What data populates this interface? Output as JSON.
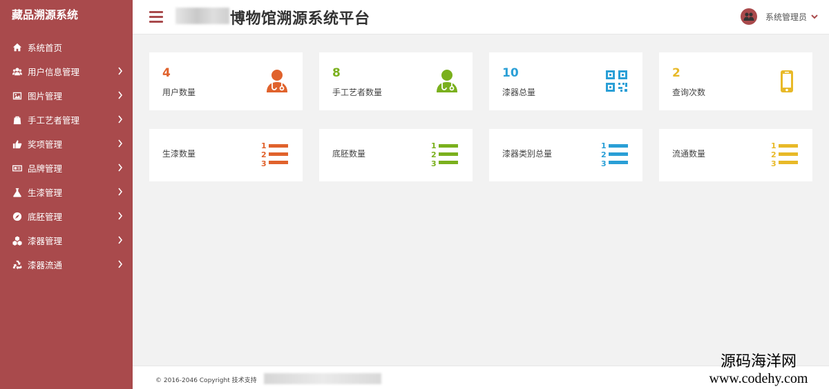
{
  "sidebar": {
    "brand": "藏品溯源系统",
    "items": [
      {
        "label": "系统首页",
        "icon": "home-icon"
      },
      {
        "label": "用户信息管理",
        "icon": "users-icon"
      },
      {
        "label": "图片管理",
        "icon": "image-icon"
      },
      {
        "label": "手工艺者管理",
        "icon": "bag-icon"
      },
      {
        "label": "奖项管理",
        "icon": "thumbs-up-icon"
      },
      {
        "label": "品牌管理",
        "icon": "id-card-icon"
      },
      {
        "label": "生漆管理",
        "icon": "flask-icon"
      },
      {
        "label": "底胚管理",
        "icon": "compass-icon"
      },
      {
        "label": "漆器管理",
        "icon": "cubes-icon"
      },
      {
        "label": "漆器流通",
        "icon": "recycle-icon"
      }
    ]
  },
  "header": {
    "title": "博物馆溯源系统平台",
    "user": "系统管理员"
  },
  "stats": [
    {
      "value": "4",
      "label": "用户数量",
      "icon": "user-doctor-icon",
      "color": "#e0622c"
    },
    {
      "value": "8",
      "label": "手工艺者数量",
      "icon": "user-doctor-icon",
      "color": "#7ab01d"
    },
    {
      "value": "10",
      "label": "漆器总量",
      "icon": "qrcode-icon",
      "color": "#2a9fd6"
    },
    {
      "value": "2",
      "label": "查询次数",
      "icon": "mobile-icon",
      "color": "#e8b928"
    }
  ],
  "lists": [
    {
      "label": "生漆数量",
      "icon": "list-ol-icon",
      "color": "#e0622c"
    },
    {
      "label": "底胚数量",
      "icon": "list-ol-icon",
      "color": "#7ab01d"
    },
    {
      "label": "漆器类别总量",
      "icon": "list-ol-icon",
      "color": "#2a9fd6"
    },
    {
      "label": "流通数量",
      "icon": "list-ol-icon",
      "color": "#e8b928"
    }
  ],
  "footer": {
    "copyright": "© 2016-2046 Copyright 技术支持"
  },
  "watermark": {
    "line1": "源码海洋网",
    "line2": "www.codehy.com"
  }
}
